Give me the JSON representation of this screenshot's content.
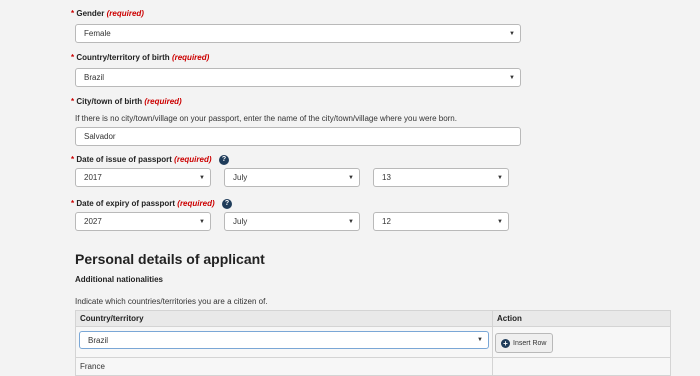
{
  "required_marker": "*",
  "required_text": "(required)",
  "help_glyph": "?",
  "caret_glyph": "▼",
  "fields": {
    "gender": {
      "label": "Gender",
      "value": "Female"
    },
    "country_birth": {
      "label": "Country/territory of birth",
      "value": "Brazil"
    },
    "city_birth": {
      "label": "City/town of birth",
      "hint": "If there is no city/town/village on your passport, enter the name of the city/town/village where you were born.",
      "value": "Salvador"
    },
    "issue_date": {
      "label": "Date of issue of passport",
      "year": "2017",
      "month": "July",
      "day": "13"
    },
    "expiry_date": {
      "label": "Date of expiry of passport",
      "year": "2027",
      "month": "July",
      "day": "12"
    }
  },
  "section": {
    "title": "Personal details of applicant",
    "subtitle": "Additional nationalities",
    "description": "Indicate which countries/territories you are a citizen of."
  },
  "table": {
    "headers": {
      "country": "Country/territory",
      "action": "Action"
    },
    "rows": [
      {
        "country": "Brazil"
      },
      {
        "country": "France"
      }
    ],
    "insert_label": "Insert Row",
    "insert_glyph": "+"
  }
}
